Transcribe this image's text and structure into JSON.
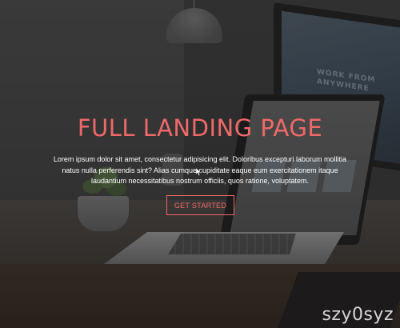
{
  "hero": {
    "title": "FULL LANDING PAGE",
    "text": "Lorem ipsum dolor sit amet, consectetur adipisicing elit. Doloribus excepturi laborum mollitia natus nulla perferendis sint? Alias cumque cupiditate eaque eum exercitationem itaque laudantium necessitatibus nostrum officiis, quos ratione, voluptatem.",
    "cta_label": "GET STARTED"
  },
  "background": {
    "monitor_headline": "WORK FROM ANYWHERE"
  },
  "watermark": "szy0syz",
  "colors": {
    "accent": "#f0696a",
    "text": "#ffffff",
    "overlay": "#1e1e1e"
  },
  "icons": {
    "cursor": "arrow-cursor-icon"
  }
}
